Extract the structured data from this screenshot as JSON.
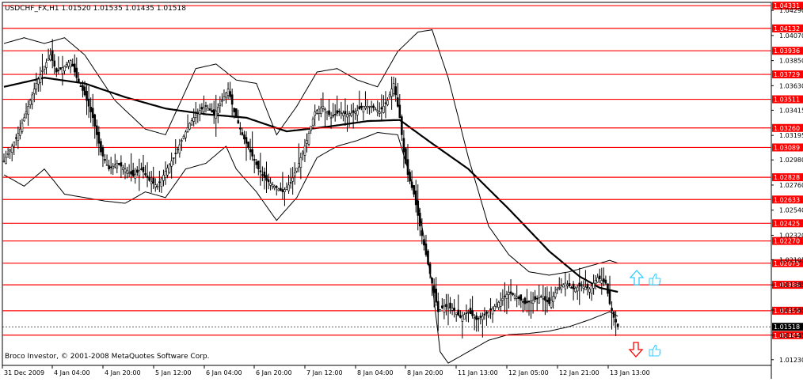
{
  "header": {
    "symbol_line": "USDCHF_FX,H1  1.01520 1.01535 1.01435 1.01518"
  },
  "footer": {
    "copyright": "Broco Investor, © 2001-2008 MetaQuotes Software Corp."
  },
  "colors": {
    "candle": "#000000",
    "bands": "#000000",
    "level_lines": "#ff0000",
    "label_bg_level": "#ff0000",
    "label_bg_current": "#000000",
    "up_arrow": "#33ccff",
    "down_arrow": "#ff0000",
    "thumb_icon": "#33ccff"
  },
  "icons": {
    "up_arrow": "up-arrow-icon",
    "down_arrow": "down-arrow-icon",
    "thumbs_up": "thumbs-up-icon"
  },
  "chart_data": {
    "type": "candlestick",
    "symbol": "USDCHF_FX",
    "timeframe": "H1",
    "last_bar": {
      "open": 1.0152,
      "high": 1.01535,
      "low": 1.01435,
      "close": 1.01518
    },
    "ylim": [
      1.0118,
      1.0436
    ],
    "y_tick_labels": [
      "1.04290",
      "1.04070",
      "1.03850",
      "1.03630",
      "1.03415",
      "1.03195",
      "1.02980",
      "1.02760",
      "1.02540",
      "1.02320",
      "1.02105",
      "1.01885",
      "1.01665",
      "1.01445",
      "1.01230"
    ],
    "x_tick_labels": [
      "31 Dec 2009",
      "4 Jan 04:00",
      "4 Jan 20:00",
      "5 Jan 12:00",
      "6 Jan 04:00",
      "6 Jan 20:00",
      "7 Jan 12:00",
      "8 Jan 04:00",
      "8 Jan 20:00",
      "11 Jan 13:00",
      "12 Jan 05:00",
      "12 Jan 21:00",
      "13 Jan 13:00"
    ],
    "levels": [
      "1.04331",
      "1.04132",
      "1.03936",
      "1.03729",
      "1.03511",
      "1.03260",
      "1.03089",
      "1.02828",
      "1.02633",
      "1.02425",
      "1.02270",
      "1.02075",
      "1.01886",
      "1.01659",
      "1.01445"
    ],
    "current_price": "1.01518",
    "close_path": [
      [
        0,
        1.0297
      ],
      [
        4,
        1.031
      ],
      [
        8,
        1.0325
      ],
      [
        12,
        1.0345
      ],
      [
        16,
        1.0365
      ],
      [
        20,
        1.038
      ],
      [
        23,
        1.039
      ],
      [
        26,
        1.0375
      ],
      [
        30,
        1.038
      ],
      [
        33,
        1.0385
      ],
      [
        36,
        1.037
      ],
      [
        40,
        1.0355
      ],
      [
        44,
        1.0335
      ],
      [
        48,
        1.0305
      ],
      [
        52,
        1.029
      ],
      [
        56,
        1.0295
      ],
      [
        60,
        1.029
      ],
      [
        64,
        1.0284
      ],
      [
        68,
        1.029
      ],
      [
        72,
        1.028
      ],
      [
        76,
        1.0275
      ],
      [
        80,
        1.0288
      ],
      [
        84,
        1.03
      ],
      [
        88,
        1.0315
      ],
      [
        92,
        1.033
      ],
      [
        96,
        1.034
      ],
      [
        100,
        1.0345
      ],
      [
        104,
        1.0338
      ],
      [
        108,
        1.035
      ],
      [
        111,
        1.036
      ],
      [
        114,
        1.034
      ],
      [
        118,
        1.032
      ],
      [
        122,
        1.0305
      ],
      [
        126,
        1.029
      ],
      [
        130,
        1.028
      ],
      [
        134,
        1.0275
      ],
      [
        138,
        1.027
      ],
      [
        142,
        1.0278
      ],
      [
        146,
        1.0295
      ],
      [
        150,
        1.0315
      ],
      [
        154,
        1.034
      ],
      [
        158,
        1.0345
      ],
      [
        162,
        1.0335
      ],
      [
        166,
        1.034
      ],
      [
        170,
        1.0338
      ],
      [
        174,
        1.034
      ],
      [
        178,
        1.0345
      ],
      [
        182,
        1.0345
      ],
      [
        186,
        1.034
      ],
      [
        190,
        1.035
      ],
      [
        193,
        1.0365
      ],
      [
        196,
        1.0335
      ],
      [
        198,
        1.0305
      ],
      [
        200,
        1.0285
      ],
      [
        203,
        1.0268
      ],
      [
        206,
        1.024
      ],
      [
        209,
        1.0215
      ],
      [
        212,
        1.019
      ],
      [
        215,
        1.0165
      ],
      [
        218,
        1.017
      ],
      [
        222,
        1.0168
      ],
      [
        226,
        1.016
      ],
      [
        230,
        1.0165
      ],
      [
        234,
        1.0158
      ],
      [
        238,
        1.0162
      ],
      [
        242,
        1.0168
      ],
      [
        246,
        1.0175
      ],
      [
        250,
        1.0182
      ],
      [
        254,
        1.0178
      ],
      [
        258,
        1.0172
      ],
      [
        262,
        1.0175
      ],
      [
        266,
        1.0178
      ],
      [
        270,
        1.0172
      ],
      [
        274,
        1.0185
      ],
      [
        278,
        1.019
      ],
      [
        282,
        1.0185
      ],
      [
        286,
        1.0188
      ],
      [
        290,
        1.0185
      ],
      [
        294,
        1.0195
      ],
      [
        298,
        1.019
      ],
      [
        300,
        1.0172
      ],
      [
        302,
        1.016
      ],
      [
        304,
        1.01518
      ]
    ],
    "ma_path": [
      [
        0,
        1.0362
      ],
      [
        20,
        1.037
      ],
      [
        40,
        1.0365
      ],
      [
        60,
        1.0353
      ],
      [
        80,
        1.0343
      ],
      [
        100,
        1.0338
      ],
      [
        120,
        1.0335
      ],
      [
        140,
        1.0323
      ],
      [
        160,
        1.0327
      ],
      [
        180,
        1.0332
      ],
      [
        196,
        1.0333
      ],
      [
        210,
        1.0315
      ],
      [
        230,
        1.029
      ],
      [
        250,
        1.0255
      ],
      [
        270,
        1.0218
      ],
      [
        285,
        1.0196
      ],
      [
        295,
        1.0186
      ],
      [
        305,
        1.0182
      ]
    ],
    "upper_band": [
      [
        0,
        1.04
      ],
      [
        10,
        1.0405
      ],
      [
        20,
        1.04
      ],
      [
        30,
        1.0405
      ],
      [
        40,
        1.039
      ],
      [
        55,
        1.035
      ],
      [
        70,
        1.0325
      ],
      [
        80,
        1.032
      ],
      [
        95,
        1.0378
      ],
      [
        105,
        1.0382
      ],
      [
        115,
        1.0368
      ],
      [
        125,
        1.0365
      ],
      [
        135,
        1.032
      ],
      [
        145,
        1.0345
      ],
      [
        155,
        1.0375
      ],
      [
        165,
        1.0378
      ],
      [
        175,
        1.0368
      ],
      [
        185,
        1.0362
      ],
      [
        195,
        1.0393
      ],
      [
        205,
        1.041
      ],
      [
        212,
        1.0412
      ],
      [
        220,
        1.037
      ],
      [
        230,
        1.03
      ],
      [
        240,
        1.024
      ],
      [
        250,
        1.0215
      ],
      [
        260,
        1.02
      ],
      [
        270,
        1.0197
      ],
      [
        280,
        1.02
      ],
      [
        290,
        1.0205
      ],
      [
        300,
        1.021
      ],
      [
        305,
        1.0207
      ]
    ],
    "lower_band": [
      [
        0,
        1.0285
      ],
      [
        10,
        1.0275
      ],
      [
        20,
        1.029
      ],
      [
        30,
        1.0268
      ],
      [
        40,
        1.0265
      ],
      [
        50,
        1.0262
      ],
      [
        60,
        1.026
      ],
      [
        70,
        1.027
      ],
      [
        80,
        1.0265
      ],
      [
        90,
        1.029
      ],
      [
        100,
        1.0295
      ],
      [
        110,
        1.031
      ],
      [
        115,
        1.029
      ],
      [
        125,
        1.027
      ],
      [
        135,
        1.0245
      ],
      [
        145,
        1.0265
      ],
      [
        155,
        1.03
      ],
      [
        165,
        1.031
      ],
      [
        175,
        1.0315
      ],
      [
        185,
        1.0322
      ],
      [
        195,
        1.032
      ],
      [
        205,
        1.026
      ],
      [
        212,
        1.019
      ],
      [
        216,
        1.013
      ],
      [
        220,
        1.012
      ],
      [
        230,
        1.013
      ],
      [
        240,
        1.014
      ],
      [
        250,
        1.0145
      ],
      [
        260,
        1.0146
      ],
      [
        270,
        1.0148
      ],
      [
        280,
        1.0152
      ],
      [
        290,
        1.0158
      ],
      [
        300,
        1.0165
      ],
      [
        305,
        1.016
      ]
    ]
  }
}
